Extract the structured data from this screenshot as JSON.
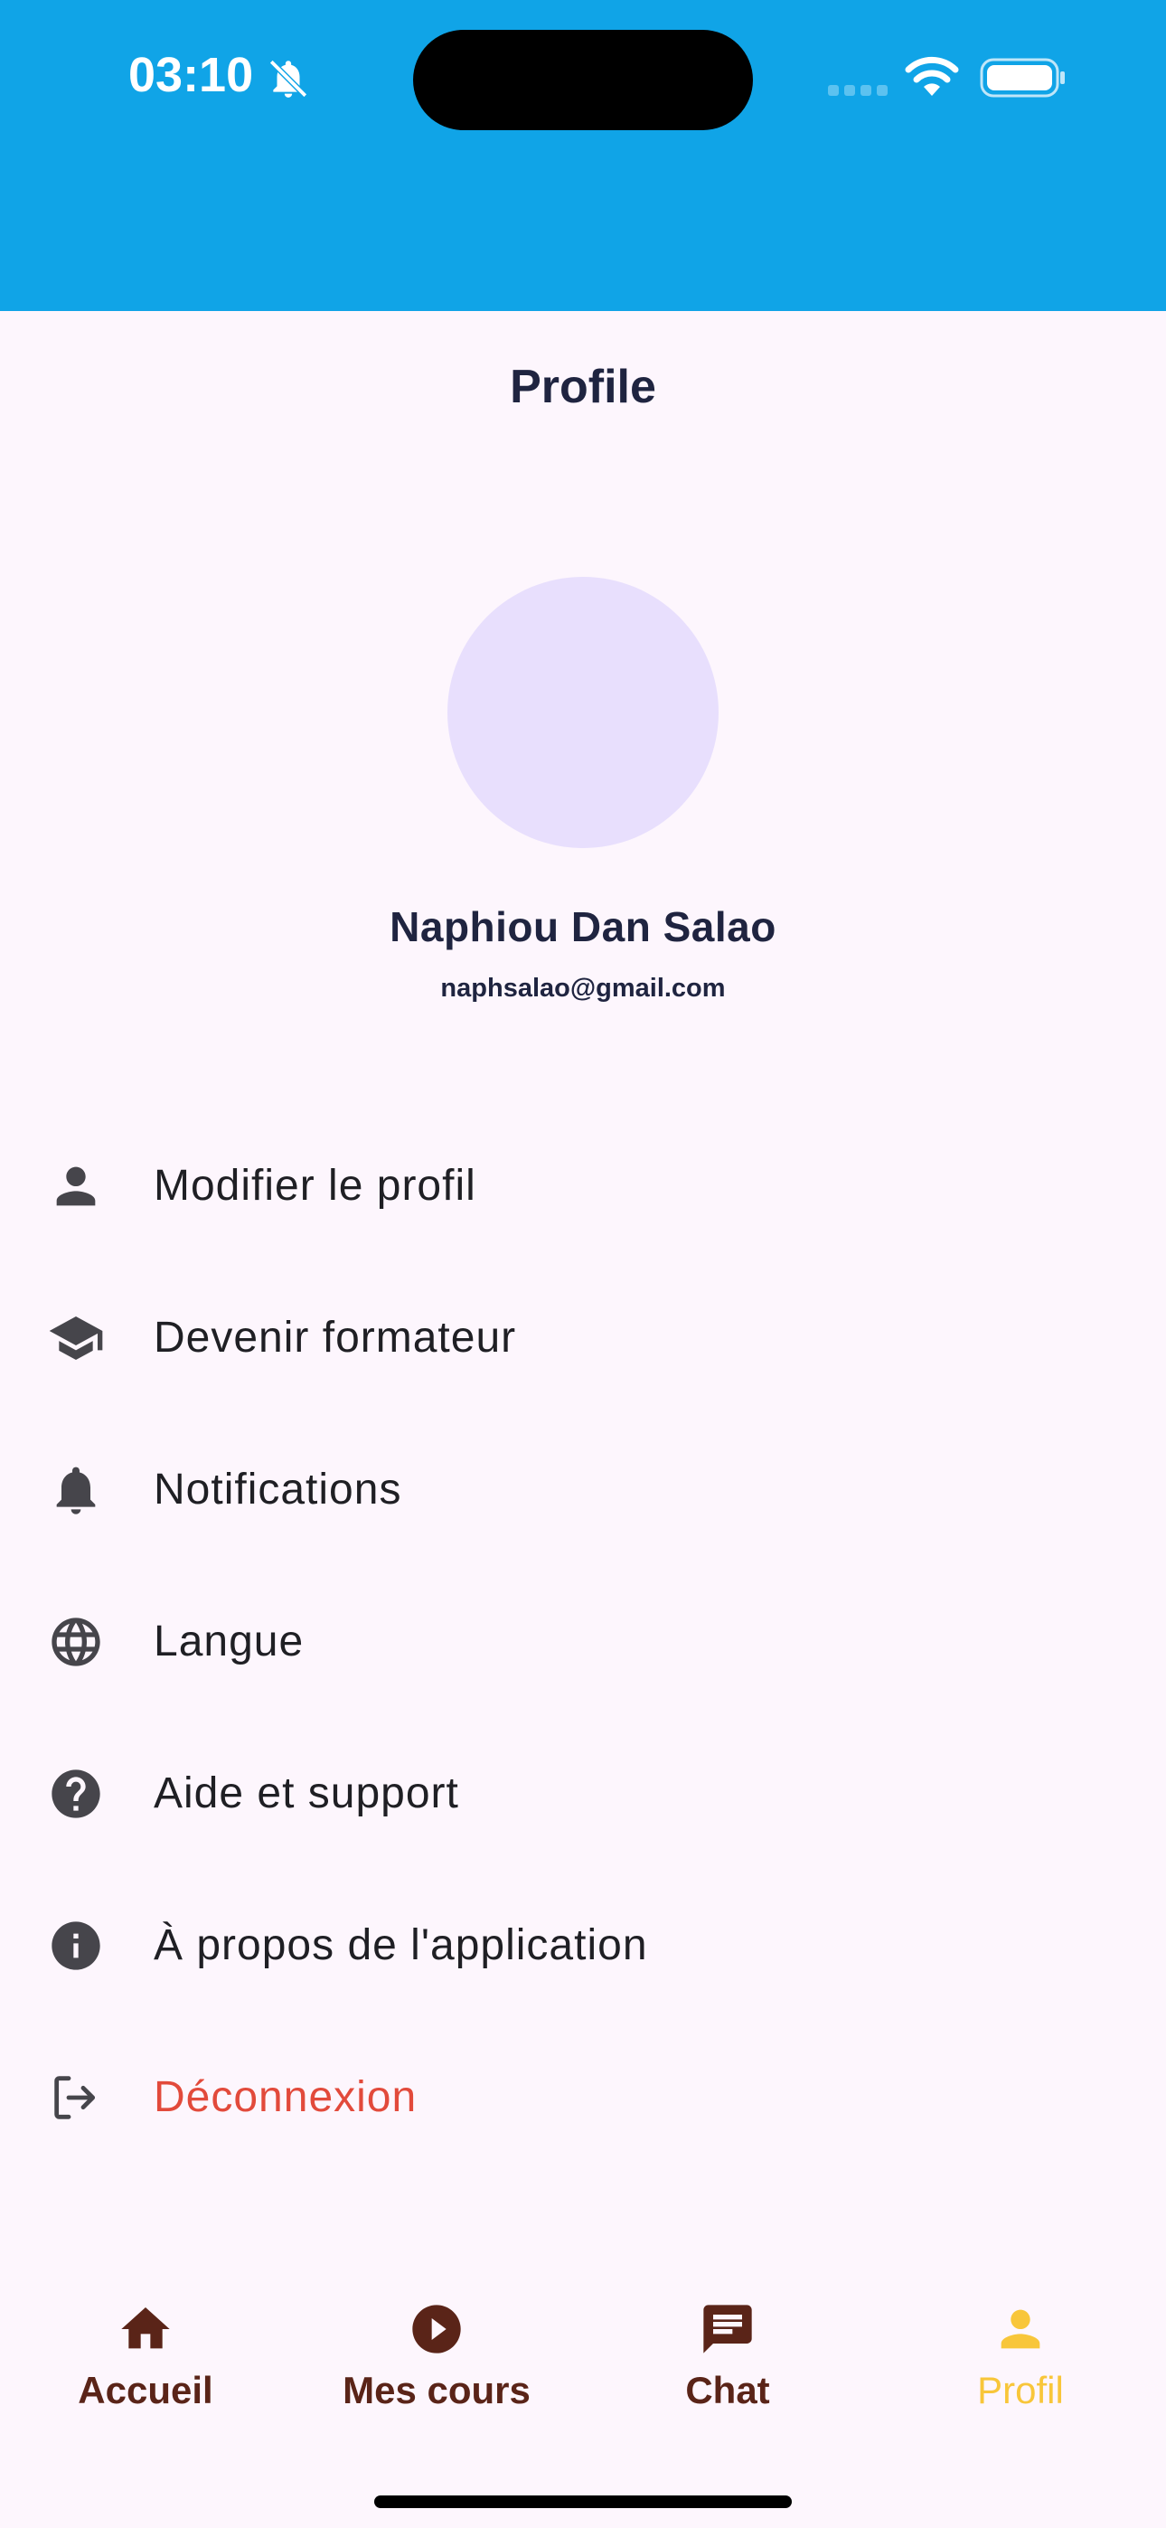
{
  "status_bar": {
    "time": "03:10"
  },
  "header": {
    "title": "Profile"
  },
  "profile": {
    "name": "Naphiou Dan Salao",
    "email": "naphsalao@gmail.com"
  },
  "menu": {
    "items": [
      {
        "label": "Modifier le profil",
        "icon": "person-icon"
      },
      {
        "label": "Devenir formateur",
        "icon": "graduation-cap-icon"
      },
      {
        "label": "Notifications",
        "icon": "bell-icon"
      },
      {
        "label": "Langue",
        "icon": "globe-icon"
      },
      {
        "label": "Aide et support",
        "icon": "help-icon"
      },
      {
        "label": "À propos de l'application",
        "icon": "info-icon"
      },
      {
        "label": "Déconnexion",
        "icon": "logout-icon"
      }
    ]
  },
  "bottom_nav": {
    "items": [
      {
        "label": "Accueil",
        "icon": "home-icon"
      },
      {
        "label": "Mes cours",
        "icon": "play-circle-icon"
      },
      {
        "label": "Chat",
        "icon": "chat-icon"
      },
      {
        "label": "Profil",
        "icon": "person-icon",
        "active": true
      }
    ]
  },
  "colors": {
    "header_blue": "#10a4e7",
    "background": "#fdf6fd",
    "avatar": "#e8dffd",
    "danger": "#e24a3b",
    "nav_inactive": "#5a2418",
    "nav_active": "#f8c63a"
  }
}
